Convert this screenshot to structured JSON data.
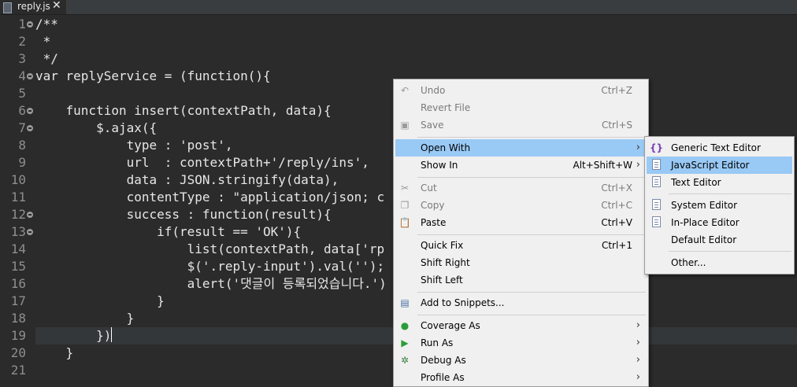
{
  "tab": {
    "filename": "reply.js",
    "close": "✕"
  },
  "editor": {
    "line_numbers": [
      "1",
      "2",
      "3",
      "4",
      "5",
      "6",
      "7",
      "8",
      "9",
      "10",
      "11",
      "12",
      "13",
      "14",
      "15",
      "16",
      "17",
      "18",
      "19",
      "20",
      "21"
    ],
    "code_lines": [
      "/**",
      " *",
      " */",
      "var replyService = (function(){",
      "",
      "    function insert(contextPath, data){",
      "        $.ajax({",
      "            type : 'post',",
      "            url  : contextPath+'/reply/ins',",
      "            data : JSON.stringify(data),",
      "            contentType : \"application/json; c",
      "            success : function(result){",
      "                if(result == 'OK'){",
      "                    list(contextPath, data['rp",
      "                    $('.reply-input').val('');",
      "                    alert('댓글이 등록되었습니다.')",
      "                }",
      "            }",
      "        })",
      "    }",
      ""
    ]
  },
  "context_menu": {
    "items": [
      {
        "label": "Undo",
        "shortcut": "Ctrl+Z",
        "enabled": false,
        "icon": "undo-icon"
      },
      {
        "label": "Revert File",
        "shortcut": "",
        "enabled": false
      },
      {
        "label": "Save",
        "shortcut": "Ctrl+S",
        "enabled": false,
        "icon": "save-icon"
      },
      {
        "label": "Open With",
        "submenu": true,
        "selected": true
      },
      {
        "label": "Show In",
        "shortcut": "Alt+Shift+W",
        "submenu": true
      },
      {
        "label": "Cut",
        "shortcut": "Ctrl+X",
        "enabled": false,
        "icon": "cut-icon"
      },
      {
        "label": "Copy",
        "shortcut": "Ctrl+C",
        "enabled": false,
        "icon": "copy-icon"
      },
      {
        "label": "Paste",
        "shortcut": "Ctrl+V",
        "icon": "paste-icon"
      },
      {
        "label": "Quick Fix",
        "shortcut": "Ctrl+1"
      },
      {
        "label": "Shift Right",
        "shortcut": ""
      },
      {
        "label": "Shift Left",
        "shortcut": ""
      },
      {
        "label": "Add to Snippets...",
        "icon": "snippets-icon"
      },
      {
        "label": "Coverage As",
        "submenu": true,
        "icon": "coverage-icon"
      },
      {
        "label": "Run As",
        "submenu": true,
        "icon": "run-icon"
      },
      {
        "label": "Debug As",
        "submenu": true,
        "icon": "debug-icon"
      },
      {
        "label": "Profile As",
        "submenu": true
      }
    ]
  },
  "open_with_submenu": {
    "items": [
      {
        "label": "Generic Text Editor",
        "icon": "generic-editor-icon"
      },
      {
        "label": "JavaScript Editor",
        "icon": "javascript-editor-icon",
        "selected": true
      },
      {
        "label": "Text Editor",
        "icon": "text-editor-icon"
      },
      {
        "label": "System Editor",
        "icon": "system-editor-icon"
      },
      {
        "label": "In-Place Editor",
        "icon": "in-place-editor-icon"
      },
      {
        "label": "Default Editor"
      },
      {
        "label": "Other..."
      }
    ]
  },
  "colors": {
    "editor_bg": "#2b2b2b",
    "menu_bg": "#f0f0f0",
    "selection": "#99c9f5",
    "run_green": "#2a9d3a"
  }
}
